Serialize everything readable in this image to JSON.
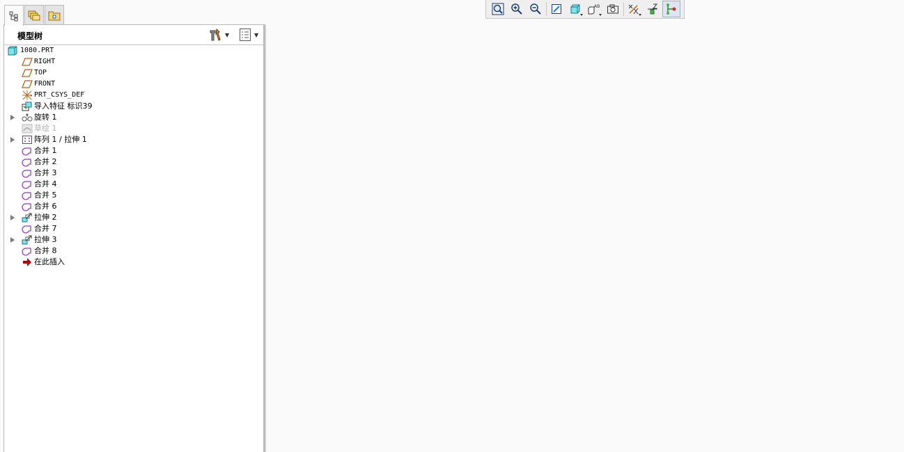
{
  "navigator": {
    "tabs": [
      {
        "icon": "model-tree-icon",
        "active": true
      },
      {
        "icon": "folder-browser-icon",
        "active": false
      },
      {
        "icon": "favorites-icon",
        "active": false
      }
    ],
    "title": "模型树",
    "settings_icon": "tree-settings-icon",
    "columns_icon": "tree-columns-icon"
  },
  "tree": {
    "root": "1080.PRT",
    "items": [
      {
        "label": "RIGHT",
        "icon": "datum-plane-icon",
        "mono": true,
        "expandable": false,
        "suppressed": false
      },
      {
        "label": "TOP",
        "icon": "datum-plane-icon",
        "mono": true,
        "expandable": false,
        "suppressed": false
      },
      {
        "label": "FRONT",
        "icon": "datum-plane-icon",
        "mono": true,
        "expandable": false,
        "suppressed": false
      },
      {
        "label": "PRT_CSYS_DEF",
        "icon": "coordinate-system-icon",
        "mono": true,
        "expandable": false,
        "suppressed": false
      },
      {
        "label": "导入特征 标识39",
        "icon": "import-feature-icon",
        "mono": false,
        "expandable": false,
        "suppressed": false
      },
      {
        "label": "旋转 1",
        "icon": "revolve-icon",
        "mono": false,
        "expandable": true,
        "suppressed": false
      },
      {
        "label": "草绘 1",
        "icon": "sketch-icon",
        "mono": false,
        "expandable": false,
        "suppressed": true
      },
      {
        "label": "阵列 1 / 拉伸 1",
        "icon": "pattern-icon",
        "mono": false,
        "expandable": true,
        "suppressed": false
      },
      {
        "label": "合并 1",
        "icon": "merge-icon",
        "mono": false,
        "expandable": false,
        "suppressed": false
      },
      {
        "label": "合并 2",
        "icon": "merge-icon",
        "mono": false,
        "expandable": false,
        "suppressed": false
      },
      {
        "label": "合并 3",
        "icon": "merge-icon",
        "mono": false,
        "expandable": false,
        "suppressed": false
      },
      {
        "label": "合并 4",
        "icon": "merge-icon",
        "mono": false,
        "expandable": false,
        "suppressed": false
      },
      {
        "label": "合并 5",
        "icon": "merge-icon",
        "mono": false,
        "expandable": false,
        "suppressed": false
      },
      {
        "label": "合并 6",
        "icon": "merge-icon",
        "mono": false,
        "expandable": false,
        "suppressed": false
      },
      {
        "label": "拉伸 2",
        "icon": "extrude-icon",
        "mono": false,
        "expandable": true,
        "suppressed": false
      },
      {
        "label": "合并 7",
        "icon": "merge-icon",
        "mono": false,
        "expandable": false,
        "suppressed": false
      },
      {
        "label": "拉伸 3",
        "icon": "extrude-icon",
        "mono": false,
        "expandable": true,
        "suppressed": false
      },
      {
        "label": "合并 8",
        "icon": "merge-icon",
        "mono": false,
        "expandable": false,
        "suppressed": false
      },
      {
        "label": "在此插入",
        "icon": "insert-here-icon",
        "mono": false,
        "expandable": false,
        "suppressed": false
      }
    ]
  },
  "toolbar": {
    "buttons": [
      {
        "icon": "refit-icon",
        "pressed": false,
        "has_menu": false
      },
      {
        "icon": "zoom-in-icon",
        "pressed": false,
        "has_menu": false
      },
      {
        "icon": "zoom-out-icon",
        "pressed": false,
        "has_menu": false
      },
      {
        "icon": "repaint-icon",
        "pressed": false,
        "has_menu": false
      },
      {
        "icon": "display-style-icon",
        "pressed": false,
        "has_menu": true
      },
      {
        "icon": "saved-orientations-icon",
        "pressed": false,
        "has_menu": true
      },
      {
        "icon": "view-manager-icon",
        "pressed": false,
        "has_menu": false
      },
      {
        "icon": "datum-display-icon",
        "pressed": false,
        "has_menu": true
      },
      {
        "icon": "annotation-display-icon",
        "pressed": false,
        "has_menu": false
      },
      {
        "icon": "spin-center-icon",
        "pressed": true,
        "has_menu": false
      }
    ]
  },
  "colors": {
    "datum_plane": "#b5651d",
    "merge": "#9b3fb5",
    "insert_arrow": "#c00000",
    "part_cyan": "#5fd6e0"
  }
}
